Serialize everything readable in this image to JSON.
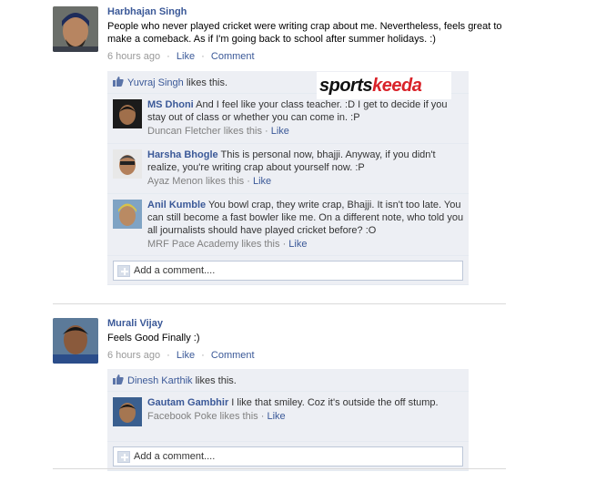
{
  "posts": [
    {
      "author": "Harbhajan Singh",
      "message": "People who never played cricket were writing crap about me. Nevertheless, feels great to make a comeback. As if I'm going back to school after summer holidays. :)",
      "time": "6 hours ago",
      "like_label": "Like",
      "comment_label": "Comment",
      "likers": "Yuvraj Singh",
      "likes_text": " likes this.",
      "comments": [
        {
          "name": "MS Dhoni",
          "text": " And I feel like your class teacher. :D I get to decide if you stay out of class or whether you can come in. :P",
          "liker": "Duncan Fletcher likes this",
          "like_label": "Like"
        },
        {
          "name": "Harsha Bhogle",
          "text": " This is personal now, bhajji. Anyway, if you didn't realize, you're writing crap about yourself now. :P",
          "liker": "Ayaz Menon likes this",
          "like_label": "Like"
        },
        {
          "name": "Anil Kumble",
          "text": " You bowl crap, they write crap, Bhajji. It isn't too late. You can still become a fast bowler like me. On a different note, who told you all journalists should have played cricket before? :O",
          "liker": "MRF Pace Academy likes this",
          "like_label": "Like"
        }
      ],
      "add_comment": "Add a comment...."
    },
    {
      "author": "Murali Vijay",
      "message": "Feels Good Finally :)",
      "time": "6 hours ago",
      "like_label": "Like",
      "comment_label": "Comment",
      "likers": "Dinesh Karthik",
      "likes_text": " likes this.",
      "comments": [
        {
          "name": "Gautam Gambhir",
          "text": " I like that smiley. Coz it's outside the off stump.",
          "liker": "Facebook Poke likes this",
          "like_label": "Like"
        }
      ],
      "add_comment": "Add a comment...."
    }
  ],
  "watermark": {
    "part1": "sports",
    "part2": "keeda"
  },
  "colors": {
    "link": "#3b5998",
    "ufi_bg": "#edeff4",
    "brand_red": "#d9232a"
  },
  "separator": "·"
}
